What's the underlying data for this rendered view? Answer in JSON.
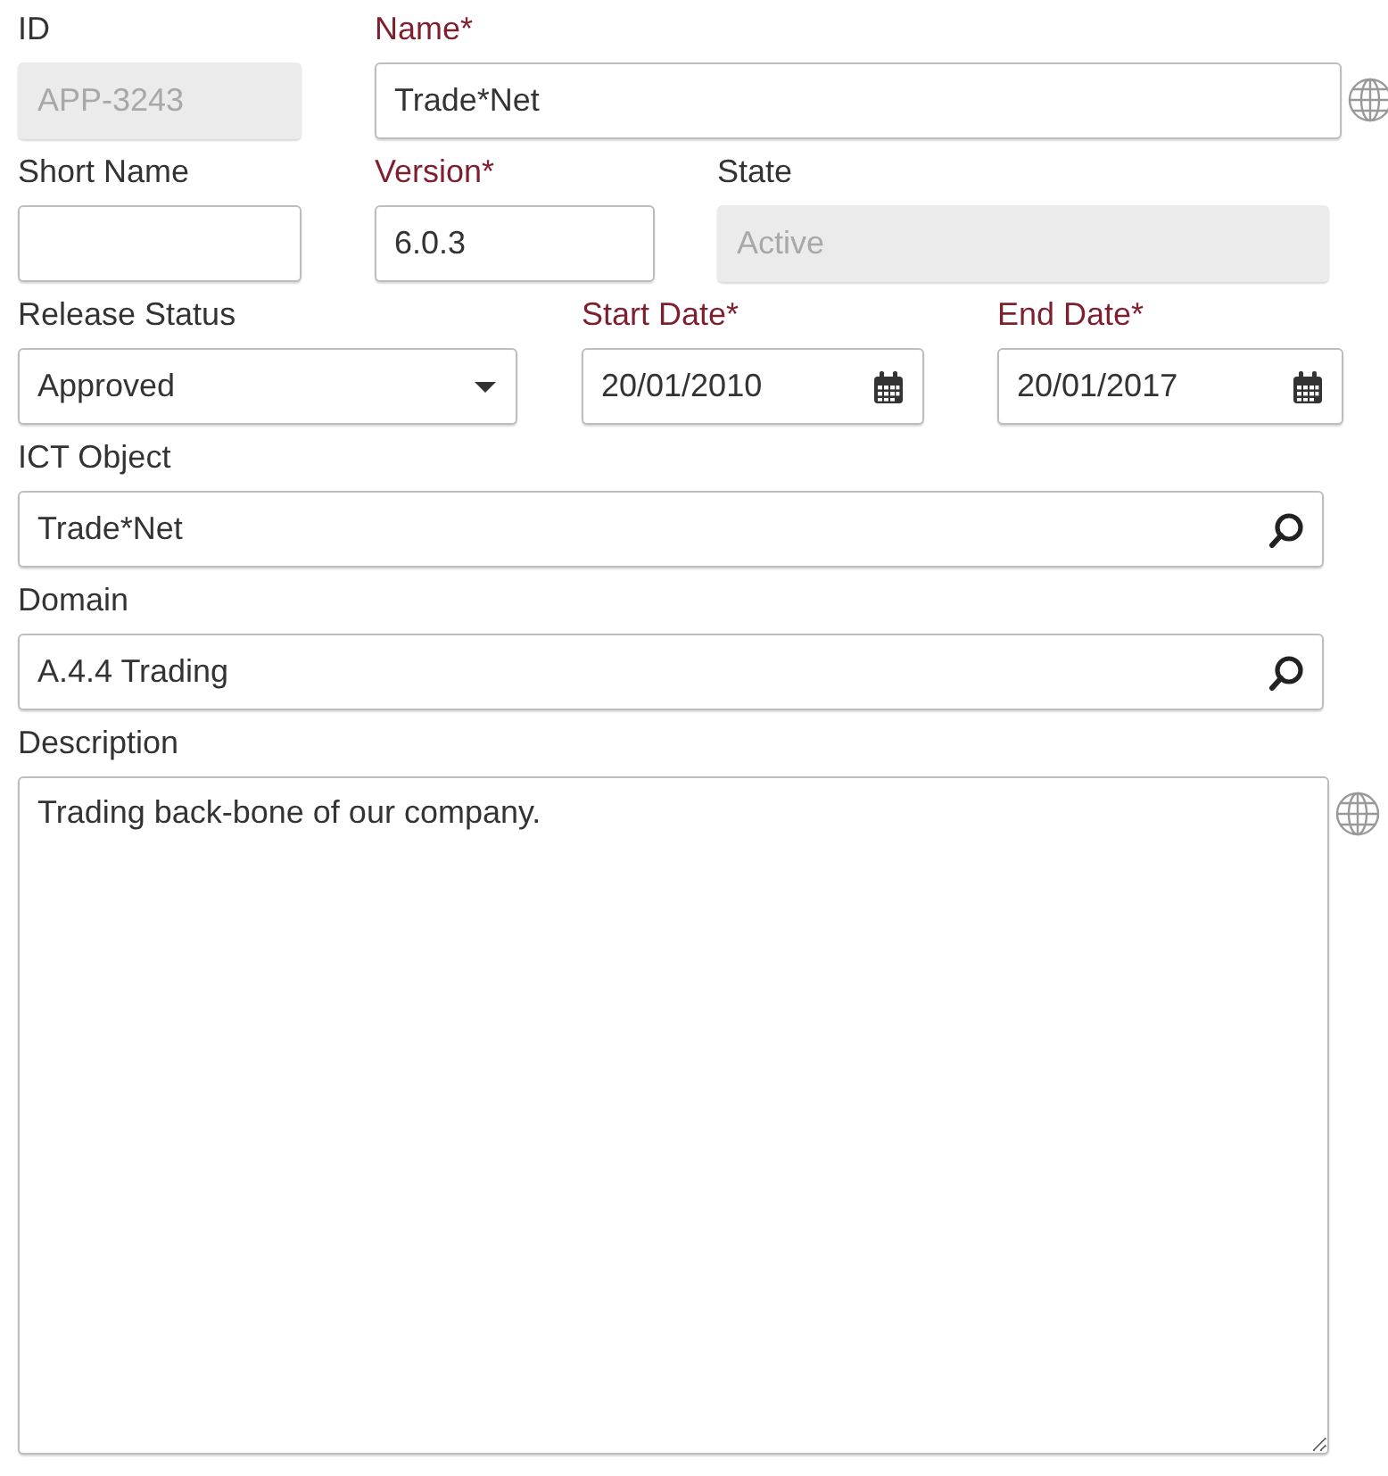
{
  "rows": [
    [
      {
        "kind": "text",
        "label": "ID",
        "required": false,
        "value": "APP-3243",
        "disabled": true,
        "translatable": false
      },
      {
        "kind": "text",
        "label": "Name*",
        "required": true,
        "value": "Trade*Net",
        "disabled": false,
        "translatable": true
      }
    ],
    [
      {
        "kind": "text",
        "label": "Short Name",
        "required": false,
        "disabled": false,
        "translatable": false
      },
      {
        "kind": "text",
        "label": "Version*",
        "required": true,
        "value": "6.0.3",
        "disabled": false,
        "translatable": false
      },
      {
        "kind": "text",
        "label": "State",
        "required": false,
        "value": "Active",
        "disabled": true,
        "translatable": false
      }
    ],
    [
      {
        "kind": "select",
        "label": "Release Status",
        "required": false,
        "value": "Approved",
        "disabled": false,
        "translatable": false
      },
      {
        "kind": "date",
        "label": "Start Date*",
        "required": true,
        "value": "20/01/2010",
        "disabled": false,
        "translatable": false
      },
      {
        "kind": "date",
        "label": "End Date*",
        "required": true,
        "value": "20/01/2017",
        "disabled": false,
        "translatable": false
      }
    ],
    [
      {
        "kind": "lookup",
        "label": "ICT Object",
        "required": false,
        "value": "Trade*Net",
        "disabled": false,
        "translatable": false
      }
    ],
    [
      {
        "kind": "lookup",
        "label": "Domain",
        "required": false,
        "value": "A.4.4 Trading",
        "disabled": false,
        "translatable": false
      }
    ],
    [
      {
        "kind": "textarea",
        "label": "Description",
        "required": false,
        "value": "Trading back-bone of our company.",
        "disabled": false,
        "translatable": true
      }
    ]
  ]
}
